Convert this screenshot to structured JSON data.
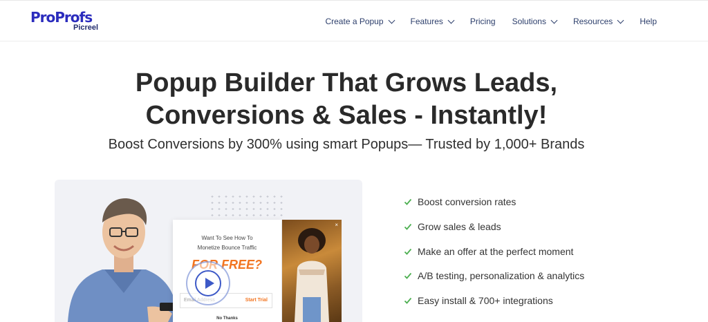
{
  "brand": {
    "logo_text_part1": "Pro",
    "logo_text_part2": "Profs",
    "logo_sub": "Picreel",
    "primary_color": "#2b2cbd",
    "accent_color": "#f06c24"
  },
  "nav": {
    "items": [
      {
        "label": "Create a Popup",
        "has_dropdown": true
      },
      {
        "label": "Features",
        "has_dropdown": true
      },
      {
        "label": "Pricing",
        "has_dropdown": false
      },
      {
        "label": "Solutions",
        "has_dropdown": true
      },
      {
        "label": "Resources",
        "has_dropdown": true
      },
      {
        "label": "Help",
        "has_dropdown": false
      }
    ]
  },
  "hero": {
    "title_line1": "Popup Builder That Grows Leads,",
    "title_line2": "Conversions & Sales - Instantly!",
    "subtitle": "Boost Conversions by 300% using smart Popups— Trusted by 1,000+ Brands"
  },
  "illustration": {
    "popup_heading_line1": "Want To See How To",
    "popup_heading_line2": "Monetize Bounce Traffic",
    "popup_offer": "FOR FREE?",
    "email_placeholder": "Email Address",
    "start_trial": "Start Trial",
    "no_thanks": "No Thanks",
    "close_symbol": "×"
  },
  "features": [
    "Boost conversion rates",
    "Grow sales & leads",
    "Make an offer at the perfect moment",
    "A/B testing, personalization & analytics",
    "Easy install & 700+ integrations"
  ],
  "colors": {
    "check": "#4caf50",
    "nav_text": "#2c3e6b",
    "offer_orange": "#f27420",
    "play_blue": "#3d59c7"
  }
}
